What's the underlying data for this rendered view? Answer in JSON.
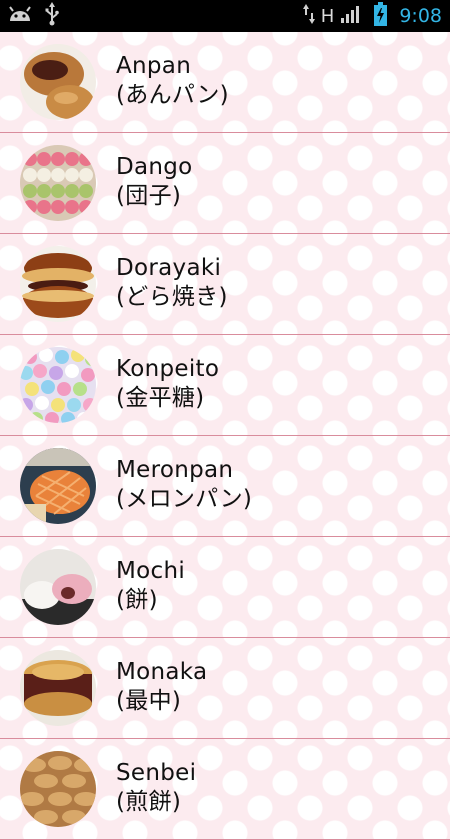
{
  "status_bar": {
    "network_type": "H",
    "time": "9:08",
    "icons": [
      "android-icon",
      "usb-icon",
      "data-transfer-icon",
      "signal-icon",
      "battery-charging-icon"
    ],
    "accent_color": "#33b5e5"
  },
  "background": {
    "base_color": "#fcebef",
    "dot_color": "#ffffff",
    "divider_color": "#d98c9c"
  },
  "items": [
    {
      "name": "Anpan",
      "jp": "(あんパン)",
      "icon": "anpan-photo"
    },
    {
      "name": "Dango",
      "jp": "(団子)",
      "icon": "dango-photo"
    },
    {
      "name": "Dorayaki",
      "jp": "(どら焼き)",
      "icon": "dorayaki-photo"
    },
    {
      "name": "Konpeito",
      "jp": "(金平糖)",
      "icon": "konpeito-photo"
    },
    {
      "name": "Meronpan",
      "jp": "(メロンパン)",
      "icon": "meronpan-photo"
    },
    {
      "name": "Mochi",
      "jp": "(餅)",
      "icon": "mochi-photo"
    },
    {
      "name": "Monaka",
      "jp": "(最中)",
      "icon": "monaka-photo"
    },
    {
      "name": "Senbei",
      "jp": "(煎餅)",
      "icon": "senbei-photo"
    }
  ]
}
